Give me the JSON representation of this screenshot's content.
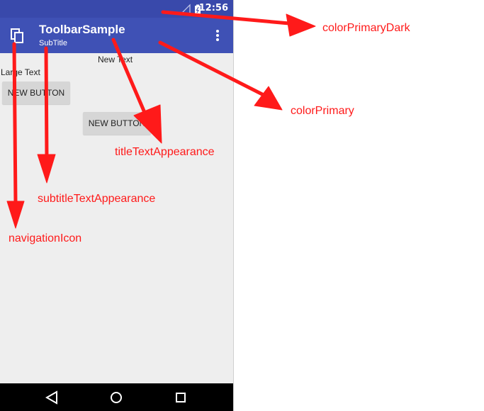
{
  "status_bar": {
    "time": "12:56",
    "color": "#3949ab"
  },
  "toolbar": {
    "title": "ToolbarSample",
    "subtitle": "SubTitle",
    "color": "#3f51b5",
    "nav_icon": "copy-icon",
    "menu_icon": "more-vert-icon"
  },
  "content": {
    "new_text": "New Text",
    "large_text": "Large Text",
    "button_1": "NEW BUTTON",
    "button_2": "NEW BUTTON"
  },
  "nav_bar": {
    "icons": [
      "back-icon",
      "home-icon",
      "recents-icon"
    ]
  },
  "annotations": {
    "color_primary_dark": "colorPrimaryDark",
    "color_primary": "colorPrimary",
    "title_text_appearance": "titleTextAppearance",
    "subtitle_text_appearance": "subtitleTextAppearance",
    "navigation_icon": "navigationIcon",
    "color": "#ff1a1a"
  }
}
